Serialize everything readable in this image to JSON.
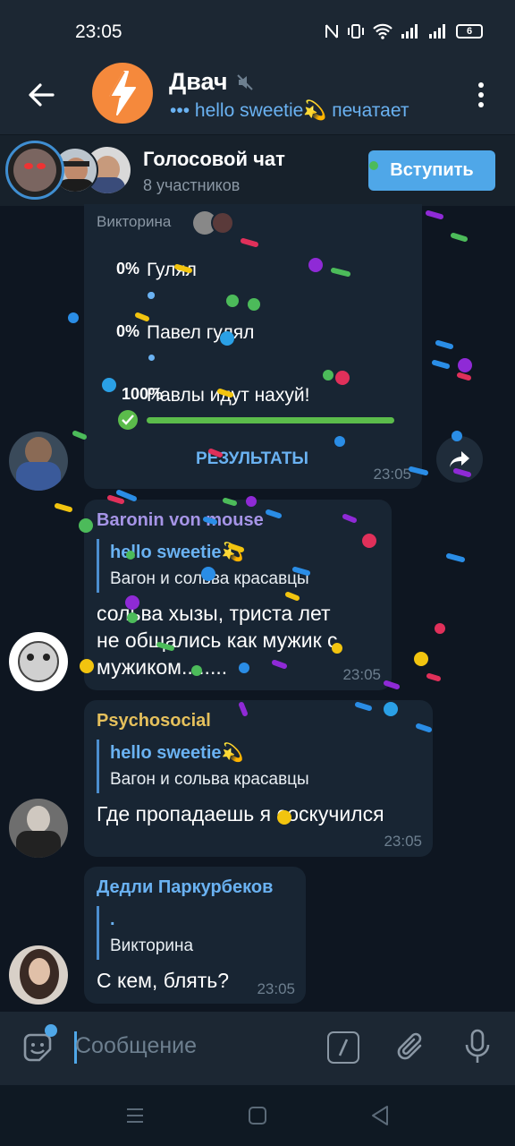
{
  "status_bar": {
    "time": "23:05",
    "battery": "6"
  },
  "header": {
    "title": "Двач",
    "status": "••• hello sweetie💫 печатает"
  },
  "voice_chat": {
    "title": "Голосовой чат",
    "participants": "8 участников",
    "join_label": "Вступить"
  },
  "poll": {
    "title": "Викторина",
    "options": [
      {
        "percent": "0%",
        "text": "Гулял",
        "fraction": 0
      },
      {
        "percent": "0%",
        "text": "Павел гулял",
        "fraction": 0
      },
      {
        "percent": "100%",
        "text": "Павлы идут нахуй!",
        "fraction": 1
      }
    ],
    "results_label": "РЕЗУЛЬТАТЫ",
    "time": "23:05"
  },
  "messages": [
    {
      "sender": "Baronin von mouse",
      "sender_color": "#a695e7",
      "reply_name": "hello sweetie💫",
      "reply_text": "Вагон и сольва красавцы",
      "text_lines": [
        "сольва хызы, триста лет",
        "не общались как мужик с",
        "мужиком........"
      ],
      "time": "23:05"
    },
    {
      "sender": "Psychosocial",
      "sender_color": "#e5c05c",
      "reply_name": "hello sweetie💫",
      "reply_text": "Вагон и сольва красавцы",
      "text_lines": [
        "Где пропадаешь я соскучился"
      ],
      "time": "23:05"
    },
    {
      "sender": "Дедли Паркурбеков",
      "sender_color": "#6ab2f2",
      "reply_name": ".",
      "reply_text": "Викторина",
      "text_lines": [
        "С кем, блять?"
      ],
      "time": "23:05"
    }
  ],
  "input": {
    "placeholder": "Сообщение"
  },
  "colors": {
    "accent": "#4fa7e8",
    "background": "#0e1621",
    "bubble": "#182533",
    "header": "#1c2733",
    "poll_bar": "#5bbc4b"
  }
}
